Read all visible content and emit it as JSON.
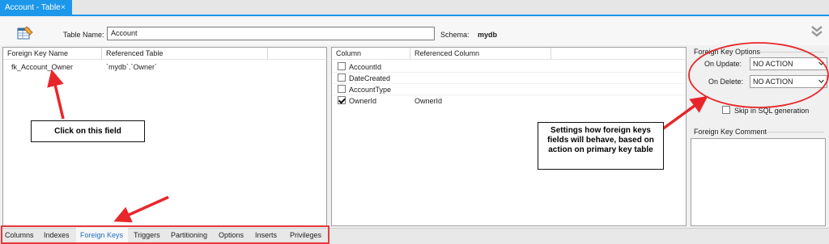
{
  "tab": {
    "title": "Account - Table",
    "close_glyph": "×"
  },
  "header": {
    "table_name_label": "Table Name:",
    "table_name_value": "Account",
    "schema_label": "Schema:",
    "schema_value": "mydb"
  },
  "fk_grid": {
    "headers": [
      "Foreign Key Name",
      "Referenced Table"
    ],
    "rows": [
      {
        "name": "fk_Account_Owner",
        "referenced_table": "`mydb`.`Owner`"
      }
    ]
  },
  "column_grid": {
    "headers": [
      "Column",
      "Referenced Column"
    ],
    "rows": [
      {
        "column": "AccountId",
        "referenced": "",
        "checked": false
      },
      {
        "column": "DateCreated",
        "referenced": "",
        "checked": false
      },
      {
        "column": "AccountType",
        "referenced": "",
        "checked": false
      },
      {
        "column": "OwnerId",
        "referenced": "OwnerId",
        "checked": true
      }
    ]
  },
  "fk_options": {
    "group_label": "Foreign Key Options",
    "on_update_label": "On Update:",
    "on_update_value": "NO ACTION",
    "on_delete_label": "On Delete:",
    "on_delete_value": "NO ACTION",
    "skip_label": "Skip in SQL generation",
    "skip_checked": false,
    "comment_label": "Foreign Key Comment"
  },
  "bottom_tabs": [
    {
      "label": "Columns",
      "active": false
    },
    {
      "label": "Indexes",
      "active": false
    },
    {
      "label": "Foreign Keys",
      "active": true
    },
    {
      "label": "Triggers",
      "active": false
    },
    {
      "label": "Partitioning",
      "active": false
    },
    {
      "label": "Options",
      "active": false
    },
    {
      "label": "Inserts",
      "active": false
    },
    {
      "label": "Privileges",
      "active": false
    }
  ],
  "annotations": {
    "click_field": "Click on this field",
    "settings_line1": "Settings how foreign keys",
    "settings_line2": "fields will behave, based on",
    "settings_line3": "action on primary key table"
  },
  "colors": {
    "accent": "#1c97ea",
    "annotation_red": "#e8262a",
    "active_tab_text": "#1c6ec4"
  },
  "icons": {
    "table_editor": "table-edit-icon",
    "collapse": "double-chevron-down-icon",
    "dropdown": "chevron-down-icon"
  }
}
